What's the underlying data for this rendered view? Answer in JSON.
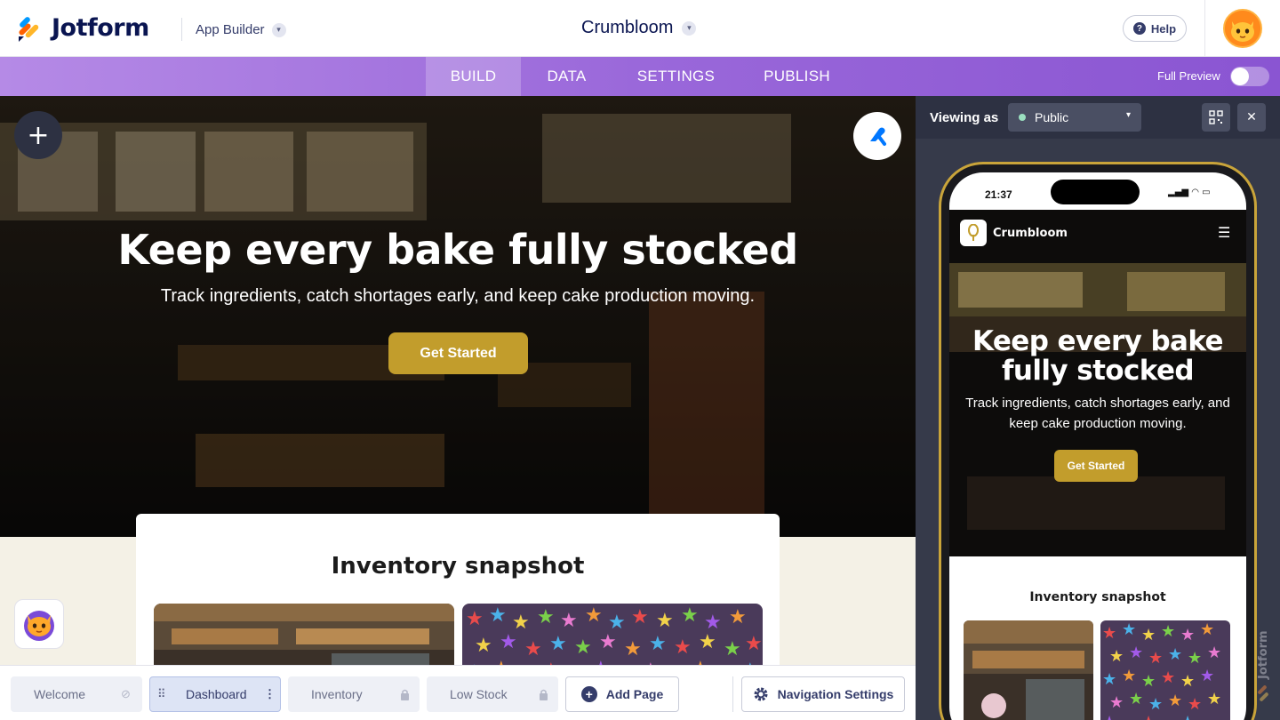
{
  "topbar": {
    "brand": "Jotform",
    "app_builder_label": "App Builder",
    "app_name": "Crumbloom",
    "help_label": "Help"
  },
  "nav": {
    "tabs": [
      {
        "label": "BUILD",
        "active": true
      },
      {
        "label": "DATA",
        "active": false
      },
      {
        "label": "SETTINGS",
        "active": false
      },
      {
        "label": "PUBLISH",
        "active": false
      }
    ],
    "full_preview_label": "Full Preview",
    "full_preview_enabled": false
  },
  "hero": {
    "title": "Keep every bake fully stocked",
    "subtitle": "Track ingredients, catch shortages early, and keep cake production moving.",
    "cta_label": "Get Started"
  },
  "section": {
    "title": "Inventory snapshot"
  },
  "pages": [
    {
      "label": "Welcome",
      "status_icon": "hidden-eye-icon"
    },
    {
      "label": "Dashboard",
      "status_icon": "more-vertical-icon",
      "active": true
    },
    {
      "label": "Inventory",
      "status_icon": "lock-icon"
    },
    {
      "label": "Low Stock",
      "status_icon": "lock-icon"
    }
  ],
  "add_page_label": "Add Page",
  "navigation_settings_label": "Navigation Settings",
  "preview": {
    "viewing_as_label": "Viewing as",
    "viewing_as_value": "Public",
    "status_time": "21:37",
    "app_name": "Crumbloom",
    "hero_title_line1": "Keep every bake",
    "hero_title_line2": "fully stocked",
    "hero_subtitle": "Track ingredients, catch shortages early, and keep cake production moving.",
    "cta_label": "Get Started",
    "section_title": "Inventory snapshot"
  },
  "colors": {
    "brand_navy": "#0a1551",
    "nav_purple": "#9a68da",
    "cta_gold": "#c29d2c",
    "panel_dark": "#363a4a",
    "cream": "#f4f1e6"
  }
}
